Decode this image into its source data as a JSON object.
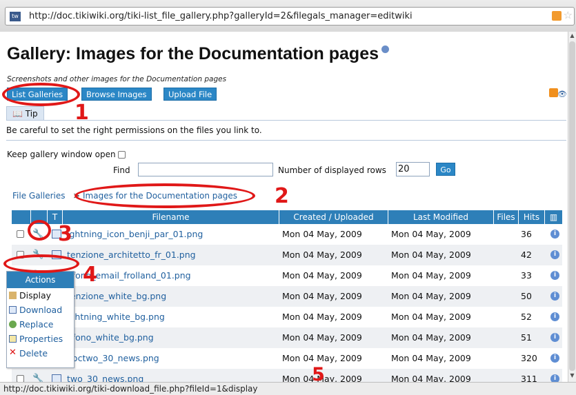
{
  "browser": {
    "url": "http://doc.tikiwiki.org/tiki-list_file_gallery.php?galleryId=2&filegals_manager=editwiki",
    "status_text": "http://doc.tikiwiki.org/tiki-download_file.php?fileId=1&display"
  },
  "page": {
    "title": "Gallery: Images for the Documentation pages",
    "subtitle": "Screenshots and other images for the Documentation pages",
    "buttons": {
      "list_galleries": "List Galleries",
      "browse_images": "Browse Images",
      "upload_file": "Upload File"
    },
    "tip": {
      "tab_label": "Tip",
      "text": "Be careful to set the right permissions on the files you link to."
    },
    "form": {
      "keep_open_label": "Keep gallery window open",
      "find_label": "Find",
      "find_value": "",
      "rows_label": "Number of displayed rows",
      "rows_value": "20",
      "go_label": "Go"
    },
    "breadcrumb": {
      "root": "File Galleries",
      "separator": ">",
      "current": "Images for the Documentation pages"
    }
  },
  "table": {
    "headers": {
      "type": "T",
      "filename": "Filename",
      "created": "Created / Uploaded",
      "modified": "Last Modified",
      "files": "Files",
      "hits": "Hits"
    },
    "rows": [
      {
        "filename": "ightning_icon_benji_par_01.png",
        "created": "Mon 04 May, 2009",
        "modified": "Mon 04 May, 2009",
        "hits": "36"
      },
      {
        "filename": "tenzione_architetto_fr_01.png",
        "created": "Mon 04 May, 2009",
        "modified": "Mon 04 May, 2009",
        "hits": "42"
      },
      {
        "filename": "efono_email_frolland_01.png",
        "created": "Mon 04 May, 2009",
        "modified": "Mon 04 May, 2009",
        "hits": "33"
      },
      {
        "filename": "tenzione_white_bg.png",
        "created": "Mon 04 May, 2009",
        "modified": "Mon 04 May, 2009",
        "hits": "50"
      },
      {
        "filename": "ightning_white_bg.png",
        "created": "Mon 04 May, 2009",
        "modified": "Mon 04 May, 2009",
        "hits": "52"
      },
      {
        "filename": "efono_white_bg.png",
        "created": "Mon 04 May, 2009",
        "modified": "Mon 04 May, 2009",
        "hits": "51"
      },
      {
        "filename": "doctwo_30_news.png",
        "created": "Mon 04 May, 2009",
        "modified": "Mon 04 May, 2009",
        "hits": "320"
      },
      {
        "filename": "two_30_news.png",
        "created": "Mon 04 May, 2009",
        "modified": "Mon 04 May, 2009",
        "hits": "311"
      }
    ]
  },
  "actions_menu": {
    "title": "Actions",
    "items": [
      "Display",
      "Download",
      "Replace",
      "Properties",
      "Delete"
    ]
  },
  "annotations": [
    "1",
    "2",
    "3",
    "4",
    "5"
  ],
  "colors": {
    "accent_blue": "#2e7fb8",
    "annotation_red": "#e01818",
    "link_blue": "#1f5f9e"
  }
}
